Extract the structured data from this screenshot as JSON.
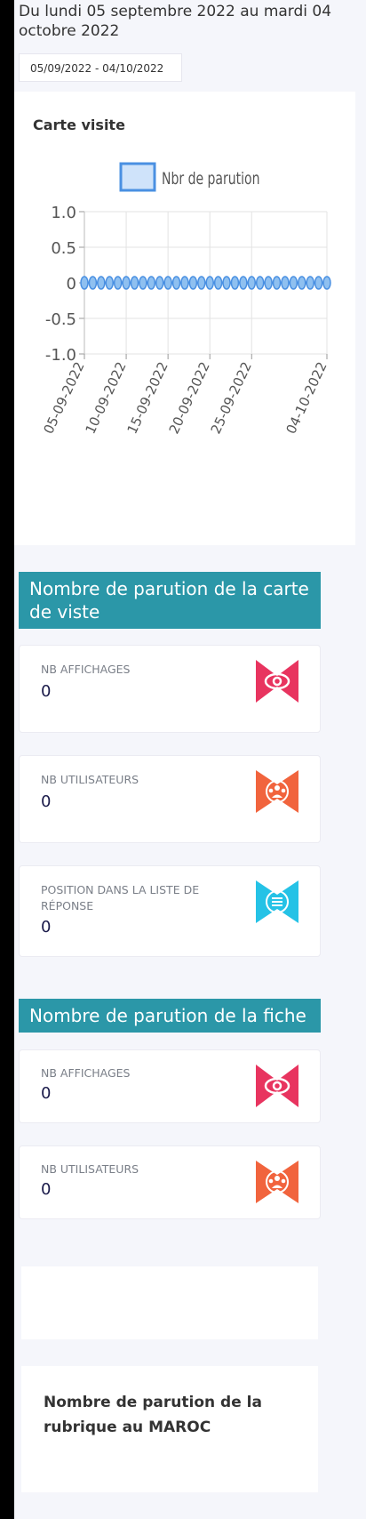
{
  "period": {
    "text": "Du lundi 05 septembre 2022 au mardi 04 octobre 2022"
  },
  "date_range": {
    "value": "05/09/2022 - 04/10/2022"
  },
  "chart_card": {
    "title": "Carte visite"
  },
  "chart_data": {
    "type": "line",
    "legend": "Nbr de parution",
    "legend_position": "top",
    "x_ticks": [
      "05-09-2022",
      "10-09-2022",
      "15-09-2022",
      "20-09-2022",
      "25-09-2022",
      "04-10-2022"
    ],
    "y_ticks": [
      "1.0",
      "0.5",
      "0",
      "-0.5",
      "-1.0"
    ],
    "ylim": [
      -1,
      1
    ],
    "grid": true,
    "series": [
      {
        "name": "Nbr de parution",
        "x": [
          "05-09-2022",
          "06-09-2022",
          "07-09-2022",
          "08-09-2022",
          "09-09-2022",
          "10-09-2022",
          "11-09-2022",
          "12-09-2022",
          "13-09-2022",
          "14-09-2022",
          "15-09-2022",
          "16-09-2022",
          "17-09-2022",
          "18-09-2022",
          "19-09-2022",
          "20-09-2022",
          "21-09-2022",
          "22-09-2022",
          "23-09-2022",
          "24-09-2022",
          "25-09-2022",
          "26-09-2022",
          "27-09-2022",
          "28-09-2022",
          "29-09-2022",
          "30-09-2022",
          "01-10-2022",
          "02-10-2022",
          "03-10-2022",
          "04-10-2022"
        ],
        "values": [
          0,
          0,
          0,
          0,
          0,
          0,
          0,
          0,
          0,
          0,
          0,
          0,
          0,
          0,
          0,
          0,
          0,
          0,
          0,
          0,
          0,
          0,
          0,
          0,
          0,
          0,
          0,
          0,
          0,
          0
        ]
      }
    ],
    "colors": {
      "line": "#4a90e2",
      "fill": "#cfe3fa",
      "grid": "#e3e3e3"
    }
  },
  "sections": {
    "carte": {
      "title": "Nombre de parution de la carte de viste",
      "stats": [
        {
          "label": "NB AFFICHAGES",
          "value": "0",
          "icon": "eye-icon",
          "color": "#e8345f"
        },
        {
          "label": "NB UTILISATEURS",
          "value": "0",
          "icon": "users-icon",
          "color": "#f1643d"
        },
        {
          "label": "POSITION DANS LA LISTE DE RÉPONSE",
          "value": "0",
          "icon": "list-icon",
          "color": "#25c2e6"
        }
      ]
    },
    "fiche": {
      "title": "Nombre de parution de la fiche",
      "stats": [
        {
          "label": "NB AFFICHAGES",
          "value": "0",
          "icon": "eye-icon",
          "color": "#e8345f"
        },
        {
          "label": "NB UTILISATEURS",
          "value": "0",
          "icon": "users-icon",
          "color": "#f1643d"
        }
      ]
    }
  },
  "rubrique": {
    "title": "Nombre de parution de la rubrique au MAROC"
  }
}
